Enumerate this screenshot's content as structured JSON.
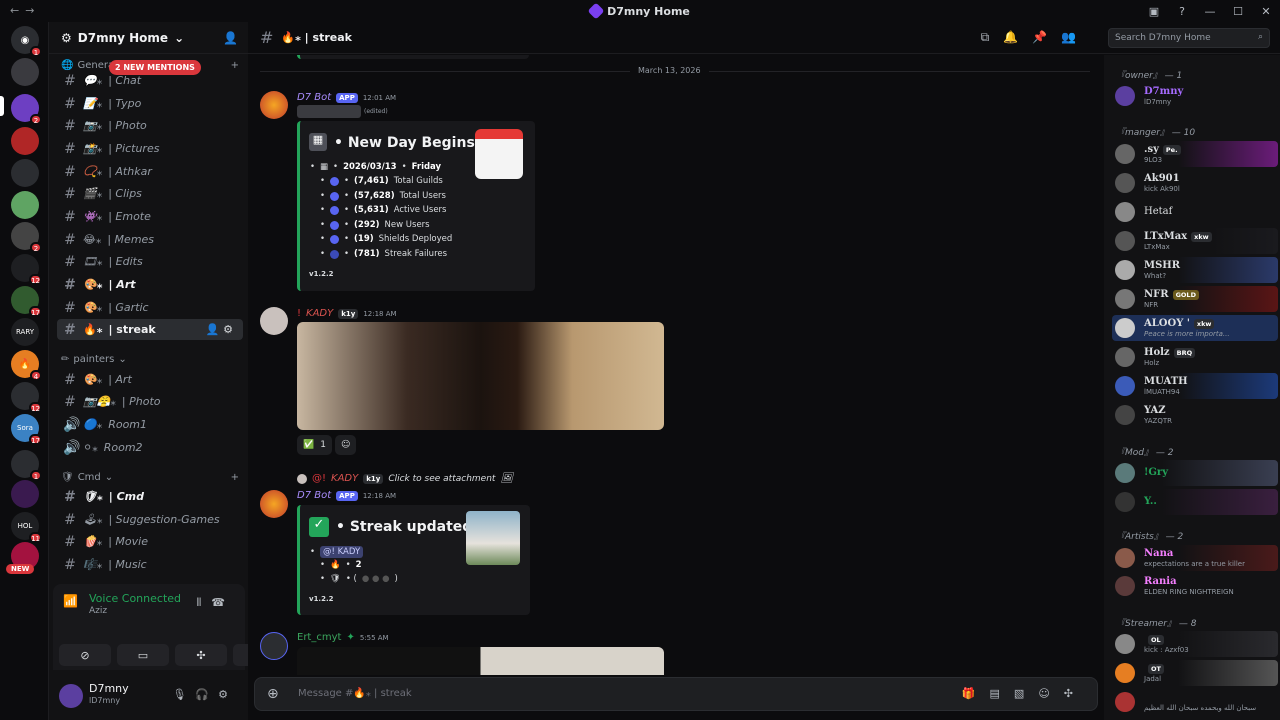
{
  "window": {
    "title": "D7mny Home"
  },
  "servers": [
    {
      "badge": "1"
    },
    {
      "badge": ""
    },
    {
      "badge": "2"
    },
    {
      "badge": ""
    },
    {
      "badge": ""
    },
    {
      "badge": ""
    },
    {
      "badge": "2"
    },
    {
      "badge": "12"
    },
    {
      "badge": "17"
    },
    {
      "badge": ""
    },
    {
      "badge": "4"
    },
    {
      "badge": ""
    },
    {
      "badge": "12"
    },
    {
      "badge": "17"
    },
    {
      "badge": "1"
    },
    {
      "badge": ""
    },
    {
      "badge": "11"
    },
    {
      "badge": "NEW"
    }
  ],
  "sidebar": {
    "server_name": "D7mny Home",
    "mention_pill": "2 NEW MENTIONS",
    "categories": [
      {
        "name": "General"
      },
      {
        "name": "painters"
      },
      {
        "name": "Cmd"
      }
    ],
    "channels": [
      {
        "label": "| Chat"
      },
      {
        "label": "| Typo"
      },
      {
        "label": "| Photo"
      },
      {
        "label": "| Pictures"
      },
      {
        "label": "| Athkar"
      },
      {
        "label": "| Clips"
      },
      {
        "label": "| Emote"
      },
      {
        "label": "| Memes"
      },
      {
        "label": "| Edits"
      },
      {
        "label": "| Art"
      },
      {
        "label": "| Gartic"
      },
      {
        "label": "| streak"
      },
      {
        "label": "| Art"
      },
      {
        "label": "| Photo"
      },
      {
        "label": "Room1"
      },
      {
        "label": "Room2"
      },
      {
        "label": "| Cmd"
      },
      {
        "label": "| Suggestion-Games"
      },
      {
        "label": "| Movie"
      },
      {
        "label": "| Music"
      }
    ],
    "voice": {
      "title": "Voice Connected",
      "sub": "Aziz"
    },
    "user": {
      "name": "D7mny",
      "status": "lD7mny"
    }
  },
  "header": {
    "channel": "🔥⁎ | streak",
    "search_placeholder": "Search D7mny Home"
  },
  "chat": {
    "date": "March 13, 2026",
    "msg1": {
      "author": "D7 Bot",
      "tag": "APP",
      "time": "12:01 AM",
      "edited": "(edited)",
      "title": "New Day Begins",
      "date_line": "2026/03/13",
      "day": "Friday",
      "stats": [
        {
          "num": "(7,461)",
          "label": "Total Guilds"
        },
        {
          "num": "(57,628)",
          "label": "Total Users"
        },
        {
          "num": "(5,631)",
          "label": "Active Users"
        },
        {
          "num": "(292)",
          "label": "New Users"
        },
        {
          "num": "(19)",
          "label": "Shields Deployed"
        },
        {
          "num": "(781)",
          "label": "Streak Failures"
        }
      ],
      "version": "v1.2.2"
    },
    "msg2": {
      "author": "KADY",
      "tag": "k1y",
      "time": "12:18 AM",
      "reaction_count": "1"
    },
    "reply": {
      "author": "KADY",
      "tag": "k1y",
      "text": "Click to see attachment"
    },
    "msg3": {
      "author": "D7 Bot",
      "tag": "APP",
      "time": "12:18 AM",
      "title": "Streak updated",
      "mention": "@! KADY",
      "streak": "2",
      "version": "v1.2.2"
    },
    "msg4": {
      "author": "Ert_cmyt",
      "time": "5:55 AM"
    },
    "input_placeholder": "Message #🔥⁎ | streak"
  },
  "members": {
    "roles": [
      {
        "name": "『owner』 — 1"
      },
      {
        "name": "『manger』 — 10"
      },
      {
        "name": "『Mod』 — 2"
      },
      {
        "name": "『Artists』 — 2"
      },
      {
        "name": "『Streamer』 — 8"
      }
    ],
    "list": [
      {
        "name": "D7mny",
        "status": "lD7mny",
        "tag": "",
        "color": "#a66bff"
      },
      {
        "name": ".sy",
        "status": "9LO3",
        "tag": "Pe.",
        "color": "#dbdee1"
      },
      {
        "name": "Ak901",
        "status": "kick Ak90l",
        "tag": "",
        "color": "#dbdee1"
      },
      {
        "name": "Hetaf",
        "status": "",
        "tag": "",
        "color": "#dbdee1"
      },
      {
        "name": "LTxMax",
        "status": "LTxMax",
        "tag": "xkw",
        "color": "#dbdee1"
      },
      {
        "name": "MSHR",
        "status": "What?",
        "tag": "",
        "color": "#dbdee1"
      },
      {
        "name": "NFR",
        "status": "NFR",
        "tag": "GOLD",
        "color": "#dbdee1"
      },
      {
        "name": "ALOOY '",
        "status": "Peace is more importa...",
        "tag": "xkw",
        "color": "#dbdee1"
      },
      {
        "name": "Holz",
        "status": "Holz",
        "tag": "BRQ",
        "color": "#dbdee1"
      },
      {
        "name": "MUATH",
        "status": "lMUATH94",
        "tag": "",
        "color": "#dbdee1"
      },
      {
        "name": "YAZ",
        "status": "YAZQTR",
        "tag": "",
        "color": "#dbdee1"
      },
      {
        "name": "!Gry",
        "status": "",
        "tag": "",
        "color": "#23a55a"
      },
      {
        "name": "Y..",
        "status": "",
        "tag": "",
        "color": "#23a55a"
      },
      {
        "name": "Nana",
        "status": "expectations are a true killer",
        "tag": "",
        "color": "#f47fff"
      },
      {
        "name": "Rania",
        "status": "ELDEN RING NIGHTREIGN",
        "tag": "",
        "color": "#f47fff"
      },
      {
        "name": "",
        "status": "kick : Azxf03",
        "tag": "OL",
        "color": "#e67e22"
      },
      {
        "name": "",
        "status": "Jadal",
        "tag": "OT",
        "color": "#e67e22"
      },
      {
        "name": "",
        "status": "سبحان الله وبحمده سبحان الله العظيم",
        "tag": "",
        "color": "#e67e22"
      }
    ]
  }
}
